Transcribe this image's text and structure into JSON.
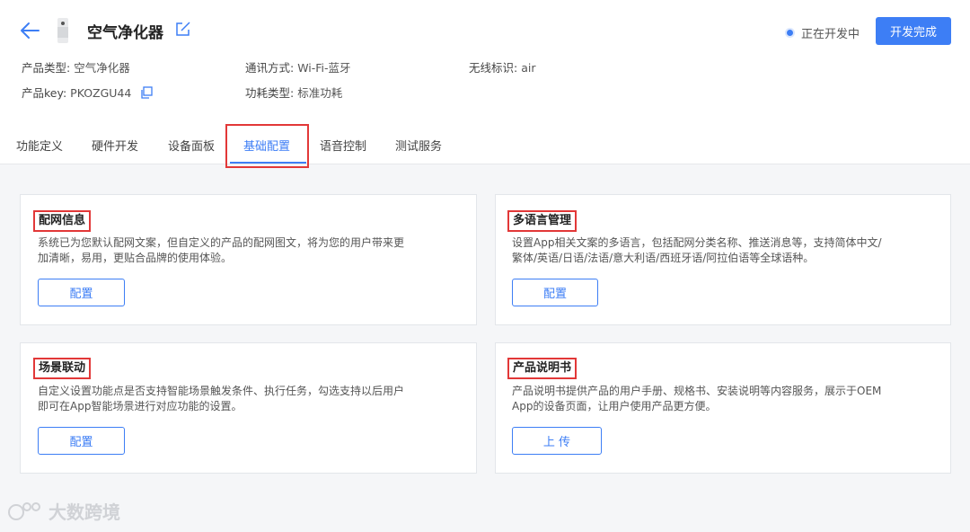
{
  "header": {
    "product_name": "空气净化器",
    "status": "正在开发中",
    "finish_button": "开发完成",
    "meta": {
      "product_type_label": "产品类型:",
      "product_type_value": "空气净化器",
      "comm_label": "通讯方式:",
      "comm_value": "Wi-Fi-蓝牙",
      "wireless_label": "无线标识:",
      "wireless_value": "air",
      "key_label": "产品key:",
      "key_value": "PKOZGU44",
      "power_label": "功耗类型:",
      "power_value": "标准功耗"
    }
  },
  "tabs": [
    {
      "label": "功能定义"
    },
    {
      "label": "硬件开发"
    },
    {
      "label": "设备面板"
    },
    {
      "label": "基础配置"
    },
    {
      "label": "语音控制"
    },
    {
      "label": "测试服务"
    }
  ],
  "cards": [
    {
      "title": "配网信息",
      "desc_line1": "系统已为您默认配网文案，但自定义的产品的配网图文，将为您的用户带来更",
      "desc_line2": "加清晰，易用，更贴合品牌的使用体验。",
      "button": "配置"
    },
    {
      "title": "多语言管理",
      "desc_line1": "设置App相关文案的多语言，包括配网分类名称、推送消息等，支持简体中文/",
      "desc_line2": "繁体/英语/日语/法语/意大利语/西班牙语/阿拉伯语等全球语种。",
      "button": "配置"
    },
    {
      "title": "场景联动",
      "desc_line1": "自定义设置功能点是否支持智能场景触发条件、执行任务，勾选支持以后用户",
      "desc_line2": "即可在App智能场景进行对应功能的设置。",
      "button": "配置"
    },
    {
      "title": "产品说明书",
      "desc_line1": "产品说明书提供产品的用户手册、规格书、安装说明等内容服务，展示于OEM",
      "desc_line2": "App的设备页面，让用户使用产品更方便。",
      "button": "上 传"
    }
  ],
  "watermark": "大数跨境",
  "colors": {
    "accent": "#3d7ef5",
    "highlight": "#e23838"
  }
}
